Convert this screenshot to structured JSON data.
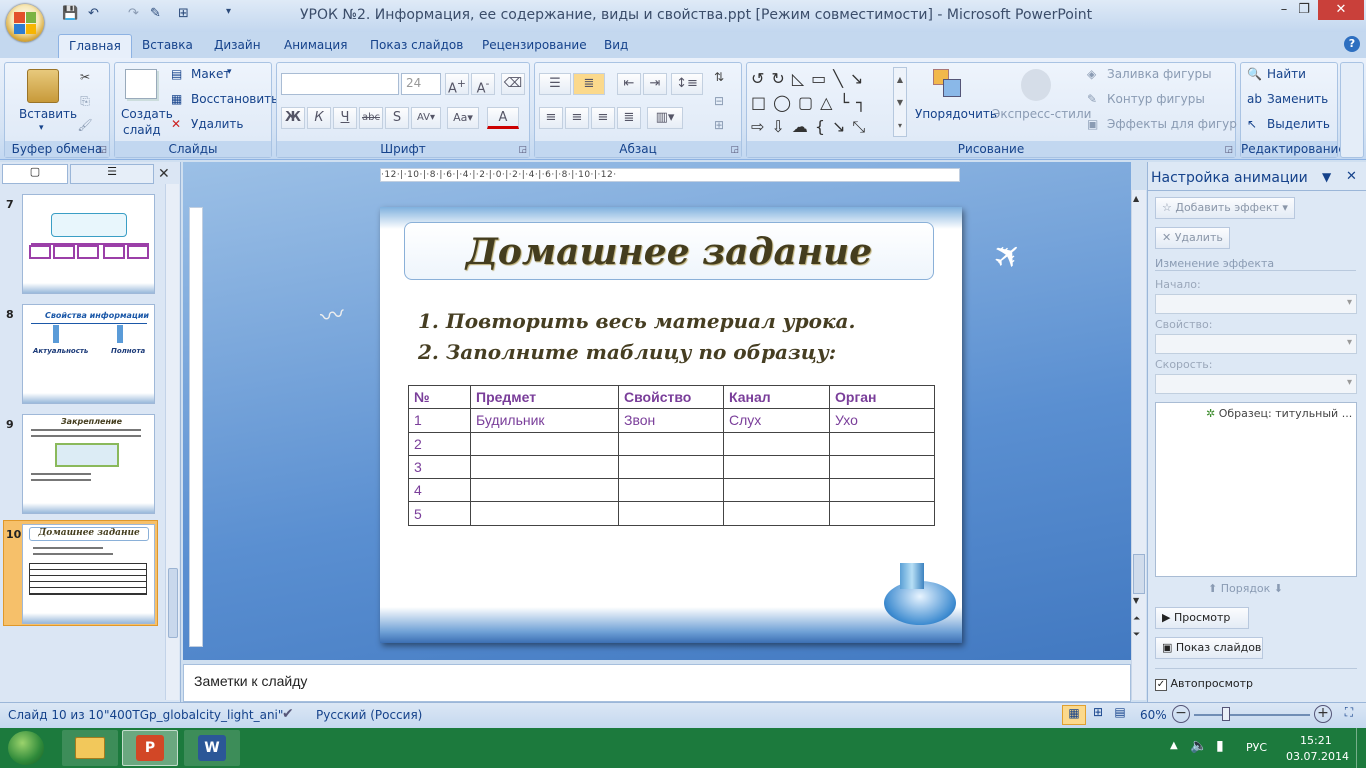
{
  "window": {
    "title": "УРОК №2. Информация, ее содержание, виды и свойства.ppt [Режим совместимости] - Microsoft PowerPoint",
    "minimize": "–",
    "restore": "❐",
    "close": "✕"
  },
  "tabs": [
    "Главная",
    "Вставка",
    "Дизайн",
    "Анимация",
    "Показ слайдов",
    "Рецензирование",
    "Вид"
  ],
  "ribbon": {
    "clipboard": {
      "label": "Буфер обмена",
      "paste": "Вставить"
    },
    "slides": {
      "label": "Слайды",
      "new_slide_1": "Создать",
      "new_slide_2": "слайд",
      "layout": "Макет",
      "reset": "Восстановить",
      "delete": "Удалить"
    },
    "font": {
      "label": "Шрифт",
      "size": "24"
    },
    "paragraph": {
      "label": "Абзац"
    },
    "drawing": {
      "label": "Рисование",
      "arrange": "Упорядочить",
      "quick_styles": "Экспресс-стили",
      "shape_fill": "Заливка фигуры",
      "shape_outline": "Контур фигуры",
      "shape_effects": "Эффекты для фигур"
    },
    "editing": {
      "label": "Редактирование",
      "find": "Найти",
      "replace": "Заменить",
      "select": "Выделить"
    }
  },
  "thumbnails": {
    "numbers": [
      "7",
      "8",
      "9",
      "10"
    ],
    "slide8_left": "Актуальность",
    "slide8_right": "Полнота",
    "slide8_title": "Свойства     информации",
    "slide9_title": "Закрепление",
    "slide10_title": "Домашнее задание"
  },
  "slide": {
    "title": "Домашнее задание",
    "task1": "1.  Повторить весь материал урока.",
    "task2": "2.  Заполните таблицу по образцу:",
    "table": {
      "headers": [
        "№",
        "Предмет",
        "Свойство",
        "Канал",
        "Орган"
      ],
      "rows": [
        [
          "1",
          "Будильник",
          "Звон",
          "Слух",
          "Ухо"
        ],
        [
          "2",
          "",
          "",
          "",
          ""
        ],
        [
          "3",
          "",
          "",
          "",
          ""
        ],
        [
          "4",
          "",
          "",
          "",
          ""
        ],
        [
          "5",
          "",
          "",
          "",
          ""
        ]
      ]
    }
  },
  "ruler": "·12·|·10·|·8·|·6·|·4·|·2·|·0·|·2·|·4·|·6·|·8·|·10·|·12·",
  "notes": {
    "placeholder": "Заметки к слайду"
  },
  "animation_pane": {
    "title": "Настройка анимации",
    "add_effect": "Добавить эффект",
    "remove": "Удалить",
    "change_effect": "Изменение эффекта",
    "start": "Начало:",
    "property": "Свойство:",
    "speed": "Скорость:",
    "list_item": "Образец: титульный ...",
    "order": "Порядок",
    "preview": "Просмотр",
    "slideshow": "Показ слайдов",
    "autopreview": "Автопросмотр"
  },
  "status": {
    "slide": "Слайд 10 из 10",
    "theme": "\"400TGp_globalcity_light_ani\"",
    "language": "Русский (Россия)",
    "zoom": "60%"
  },
  "taskbar": {
    "lang": "РУС",
    "time": "15:21",
    "date": "03.07.2014"
  },
  "colors": {
    "ribbon": "#dbe7f5",
    "slide_bg": "#5a8fd1",
    "table_text": "#7a3e9a",
    "title_text": "#443d1e"
  }
}
